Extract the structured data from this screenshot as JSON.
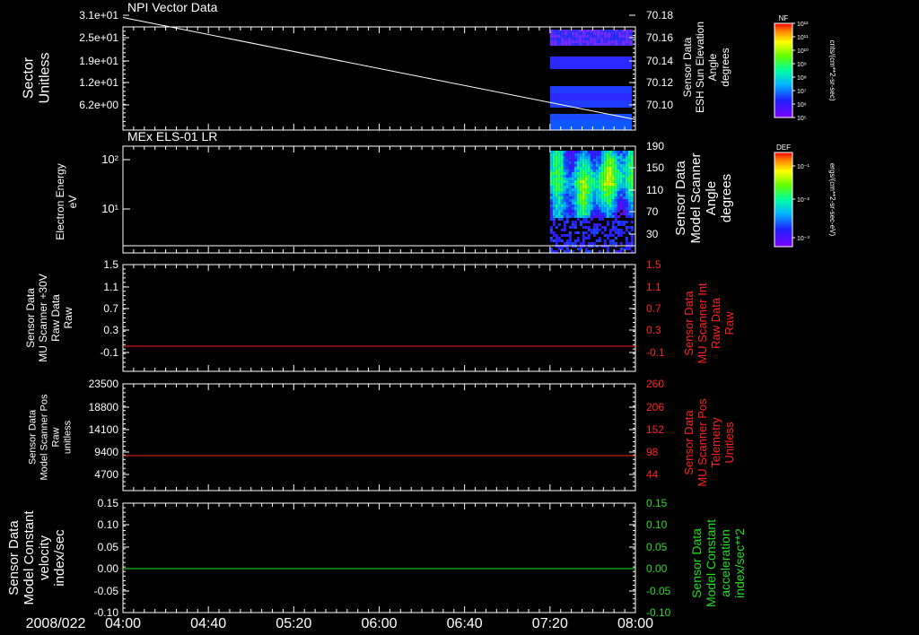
{
  "date": "2008/022",
  "x_ticks": [
    "04:00",
    "04:40",
    "05:20",
    "06:00",
    "06:40",
    "07:20",
    "08:00"
  ],
  "colors": {
    "red": "#ff2020",
    "green": "#22dd22",
    "white": "#ffffff"
  },
  "colorbars": [
    {
      "title": "NF",
      "unit": "cnts/(cm**2-sr-sec)",
      "ticks": [
        "10¹²",
        "10¹¹",
        "10¹⁰",
        "10⁹",
        "10⁸",
        "10⁷",
        "10⁶",
        "10⁵"
      ]
    },
    {
      "title": "DEF",
      "unit": "ergs/(cm**2-sr-sec-eV)",
      "ticks": [
        "10⁻¹",
        "10⁻²",
        "10⁻³"
      ]
    }
  ],
  "chart_data": [
    {
      "type": "heatmap",
      "title": "NPI Vector Data",
      "ylabel": "Sector\nUnitless",
      "y_ticks": [
        "3.1e+01",
        "2.5e+01",
        "1.9e+01",
        "1.2e+01",
        "6.2e+00"
      ],
      "y2label": "Sensor Data\nESH Sun Elevation\nAngle\ndegrees",
      "y2_ticks": [
        "70.18",
        "70.16",
        "70.14",
        "70.12",
        "70.10"
      ],
      "y2lim": [
        70.08,
        70.18
      ],
      "overlay_line": {
        "x": [
          "04:00",
          "08:00"
        ],
        "y2": [
          70.178,
          70.087
        ]
      },
      "data_start": "07:20"
    },
    {
      "type": "heatmap",
      "title": "MEx ELS-01 LR",
      "ylabel": "Electron Energy\neV",
      "y_ticks": [
        "10²",
        "10¹"
      ],
      "y2label": "Sensor Data\nModel Scanner\nAngle\ndegrees",
      "y2_ticks": [
        "190",
        "150",
        "110",
        "70",
        "30"
      ],
      "y2lim": [
        0,
        190
      ],
      "overlay_line": {
        "x": [
          "04:00",
          "08:00"
        ],
        "y2": [
          5,
          5
        ]
      },
      "data_start": "07:20"
    },
    {
      "type": "line",
      "ylabel": "Sensor Data\nMU Scanner +30V\nRaw Data\nRaw",
      "y_ticks": [
        "1.5",
        "1.1",
        "0.7",
        "0.3",
        "-0.1"
      ],
      "ylim": [
        -0.3,
        1.5
      ],
      "y2label": "Sensor Data\nMU Scanner Int\nRaw Data\nRaw",
      "y2_ticks": [
        "1.5",
        "1.1",
        "0.7",
        "0.3",
        "-0.1"
      ],
      "series": [
        {
          "x": [
            "04:00",
            "08:00"
          ],
          "values": [
            0.0,
            0.0
          ],
          "color": "#ff2020"
        }
      ]
    },
    {
      "type": "line",
      "ylabel": "Sensor Data\nModel Scanner Pos\nRaw\nunitless",
      "y_ticks": [
        "23500",
        "18800",
        "14100",
        "9400",
        "4700"
      ],
      "ylim": [
        0,
        23500
      ],
      "y2label": "Sensor Data\nMU Scanner Pos\nTelemetry\nUnitless",
      "y2_ticks": [
        "260",
        "206",
        "152",
        "98",
        "44"
      ],
      "series": [
        {
          "x": [
            "04:00",
            "08:00"
          ],
          "values": [
            7800,
            7800
          ],
          "color": "#ff2020"
        }
      ]
    },
    {
      "type": "line",
      "ylabel": "Sensor Data\nModel Constant\nvelocity\nindex/sec",
      "y_ticks": [
        "0.15",
        "0.10",
        "0.05",
        "0.00",
        "-0.05",
        "-0.10"
      ],
      "ylim": [
        -0.1,
        0.15
      ],
      "y2label": "Sensor Data\nModel Constant\nacceleration\nindex/sec**2",
      "y2_ticks": [
        "0.15",
        "0.10",
        "0.05",
        "0.00",
        "-0.05",
        "-0.10"
      ],
      "series": [
        {
          "x": [
            "04:00",
            "08:00"
          ],
          "values": [
            0.0,
            0.0
          ],
          "color": "#22dd22"
        }
      ]
    }
  ]
}
